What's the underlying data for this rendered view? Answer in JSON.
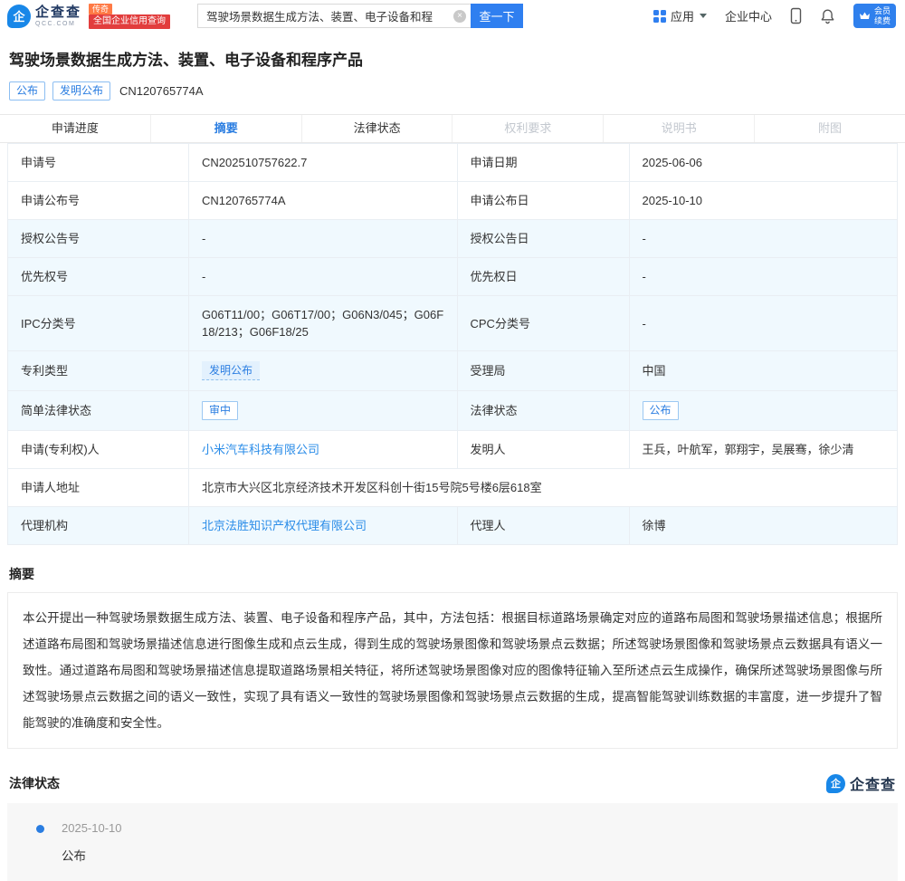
{
  "header": {
    "logo": {
      "icon_char": "企",
      "name": "企查查",
      "domain": "QCC.COM",
      "badge_top": "传奇",
      "badge_bottom": "全国企业信用查询"
    },
    "search": {
      "value": "驾驶场景数据生成方法、装置、电子设备和程",
      "clear": "×",
      "button": "查一下"
    },
    "nav": {
      "apps": "应用",
      "enterprise_center": "企业中心",
      "vip_line1": "会员",
      "vip_line2": "续费"
    }
  },
  "patent": {
    "title": "驾驶场景数据生成方法、装置、电子设备和程序产品",
    "tag_publish": "公布",
    "tag_type": "发明公布",
    "number": "CN120765774A"
  },
  "tabs": [
    {
      "label": "申请进度"
    },
    {
      "label": "摘要"
    },
    {
      "label": "法律状态"
    },
    {
      "label": "权利要求"
    },
    {
      "label": "说明书"
    },
    {
      "label": "附图"
    }
  ],
  "table": {
    "rows": [
      {
        "l1": "申请号",
        "v1": "CN202510757622.7",
        "l2": "申请日期",
        "v2": "2025-06-06"
      },
      {
        "l1": "申请公布号",
        "v1": "CN120765774A",
        "l2": "申请公布日",
        "v2": "2025-10-10"
      },
      {
        "l1": "授权公告号",
        "v1": "-",
        "l2": "授权公告日",
        "v2": "-"
      },
      {
        "l1": "优先权号",
        "v1": "-",
        "l2": "优先权日",
        "v2": "-"
      },
      {
        "l1": "IPC分类号",
        "v1": "G06T11/00；G06T17/00；G06N3/045；G06F18/213；G06F18/25",
        "l2": "CPC分类号",
        "v2": "-"
      },
      {
        "l1": "专利类型",
        "v1": "发明公布",
        "l2": "受理局",
        "v2": "中国"
      },
      {
        "l1": "简单法律状态",
        "v1": "审中",
        "l2": "法律状态",
        "v2": "公布"
      },
      {
        "l1": "申请(专利权)人",
        "v1": "小米汽车科技有限公司",
        "l2": "发明人",
        "v2": "王兵，叶航军，郭翔宇，吴展骞，徐少清"
      },
      {
        "l1": "申请人地址",
        "v1": "北京市大兴区北京经济技术开发区科创十街15号院5号楼6层618室"
      },
      {
        "l1": "代理机构",
        "v1": "北京法胜知识产权代理有限公司",
        "l2": "代理人",
        "v2": "徐博"
      }
    ]
  },
  "abstract": {
    "heading": "摘要",
    "text": "本公开提出一种驾驶场景数据生成方法、装置、电子设备和程序产品，其中，方法包括：根据目标道路场景确定对应的道路布局图和驾驶场景描述信息；根据所述道路布局图和驾驶场景描述信息进行图像生成和点云生成，得到生成的驾驶场景图像和驾驶场景点云数据；所述驾驶场景图像和驾驶场景点云数据具有语义一致性。通过道路布局图和驾驶场景描述信息提取道路场景相关特征，将所述驾驶场景图像对应的图像特征输入至所述点云生成操作，确保所述驾驶场景图像与所述驾驶场景点云数据之间的语义一致性，实现了具有语义一致性的驾驶场景图像和驾驶场景点云数据的生成，提高智能驾驶训练数据的丰富度，进一步提升了智能驾驶的准确度和安全性。"
  },
  "legal": {
    "heading": "法律状态",
    "logo_text": "企查查",
    "items": [
      {
        "date": "2025-10-10",
        "status": "公布"
      }
    ]
  },
  "colors": {
    "brand_blue": "#1887e8",
    "accent_blue": "#2a7de1",
    "badge_red": "#e23d3d",
    "badge_orange": "#ff7a45"
  }
}
